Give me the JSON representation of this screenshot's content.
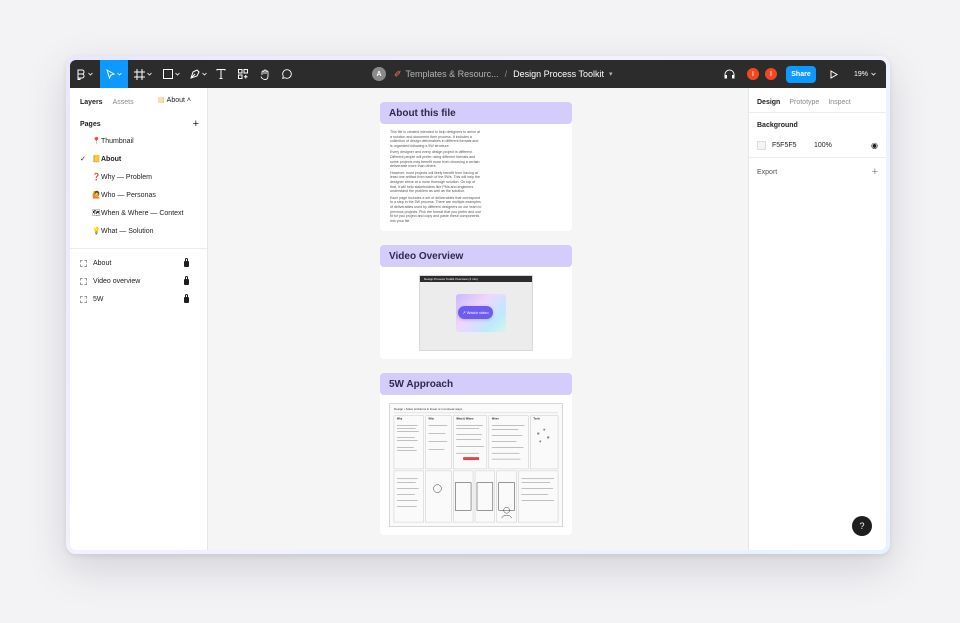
{
  "toolbar": {
    "tools": [
      {
        "name": "main-menu-icon"
      },
      {
        "name": "move-tool-icon",
        "active": true
      },
      {
        "name": "frame-tool-icon"
      },
      {
        "name": "shape-tool-icon"
      },
      {
        "name": "pen-tool-icon"
      },
      {
        "name": "text-tool-icon"
      },
      {
        "name": "resources-icon"
      },
      {
        "name": "hand-tool-icon"
      },
      {
        "name": "comment-icon"
      }
    ],
    "avatar_initial": "A",
    "breadcrumb": "Templates & Resourc...",
    "separator": "/",
    "document_title": "Design Process Toolkit",
    "user_initials": [
      "I",
      "I"
    ],
    "share_label": "Share",
    "zoom": "19%"
  },
  "left_panel": {
    "tabs": [
      "Layers",
      "Assets"
    ],
    "current_page": "About",
    "pages_title": "Pages",
    "pages": [
      {
        "emoji": "📍",
        "label": "Thumbnail"
      },
      {
        "emoji": "📒",
        "label": "About",
        "active": true
      },
      {
        "emoji": "❓",
        "label": "Why — Problem"
      },
      {
        "emoji": "🙋",
        "label": "Who — Personas"
      },
      {
        "emoji": "🗺",
        "label": "When & Where — Context"
      },
      {
        "emoji": "💡",
        "label": "What — Solution"
      }
    ],
    "layers": [
      {
        "label": "About"
      },
      {
        "label": "Video overview"
      },
      {
        "label": "5W"
      }
    ]
  },
  "canvas": {
    "cards": [
      {
        "title": "About this file",
        "paragraphs": [
          "This file is created intended to help designers to arrive at a solution and document their process. It includes a collection of design deliverables in different formats and is organized following a 5W structure.",
          "Every designer and every design project is different. Different people will prefer using different formats and some projects may benefit more from choosing a certain deliverable more than others.",
          "However, most projects will likely benefit from having at least one artifact from each of the 5Ws. This will help the designer arrive at a more thorough solution. On top of that, it will help stakeholders like PMs and engineers understand the problem as well as the solution.",
          "Each page includes a set of deliverables that correspond to a step in the 5W process. There are multiple examples of deliverables used by different designers on our team to previous projects. Pick the format that you prefer and use fit for you project and copy and paste these components into your file."
        ]
      },
      {
        "title": "Video Overview",
        "video_bar_text": "Design Process Toolkit Overview (4 min)",
        "watch_label": "Watch video"
      },
      {
        "title": "5W Approach",
        "diagram_caption": "Design • Solve problems in linear or non-linear ways",
        "columns": [
          "Why",
          "Who",
          "What & Where",
          "When",
          "Tools"
        ]
      }
    ]
  },
  "right_panel": {
    "tabs": [
      "Design",
      "Prototype",
      "Inspect"
    ],
    "background_title": "Background",
    "background_hex": "F5F5F5",
    "background_opacity": "100%",
    "export_label": "Export"
  },
  "help_label": "?",
  "colors": {
    "toolbar_bg": "#2c2c2c",
    "accent": "#0d99ff",
    "card_header": "#d4ccfa",
    "canvas_bg": "#F5F5F5",
    "user_dot": "#f24822"
  }
}
